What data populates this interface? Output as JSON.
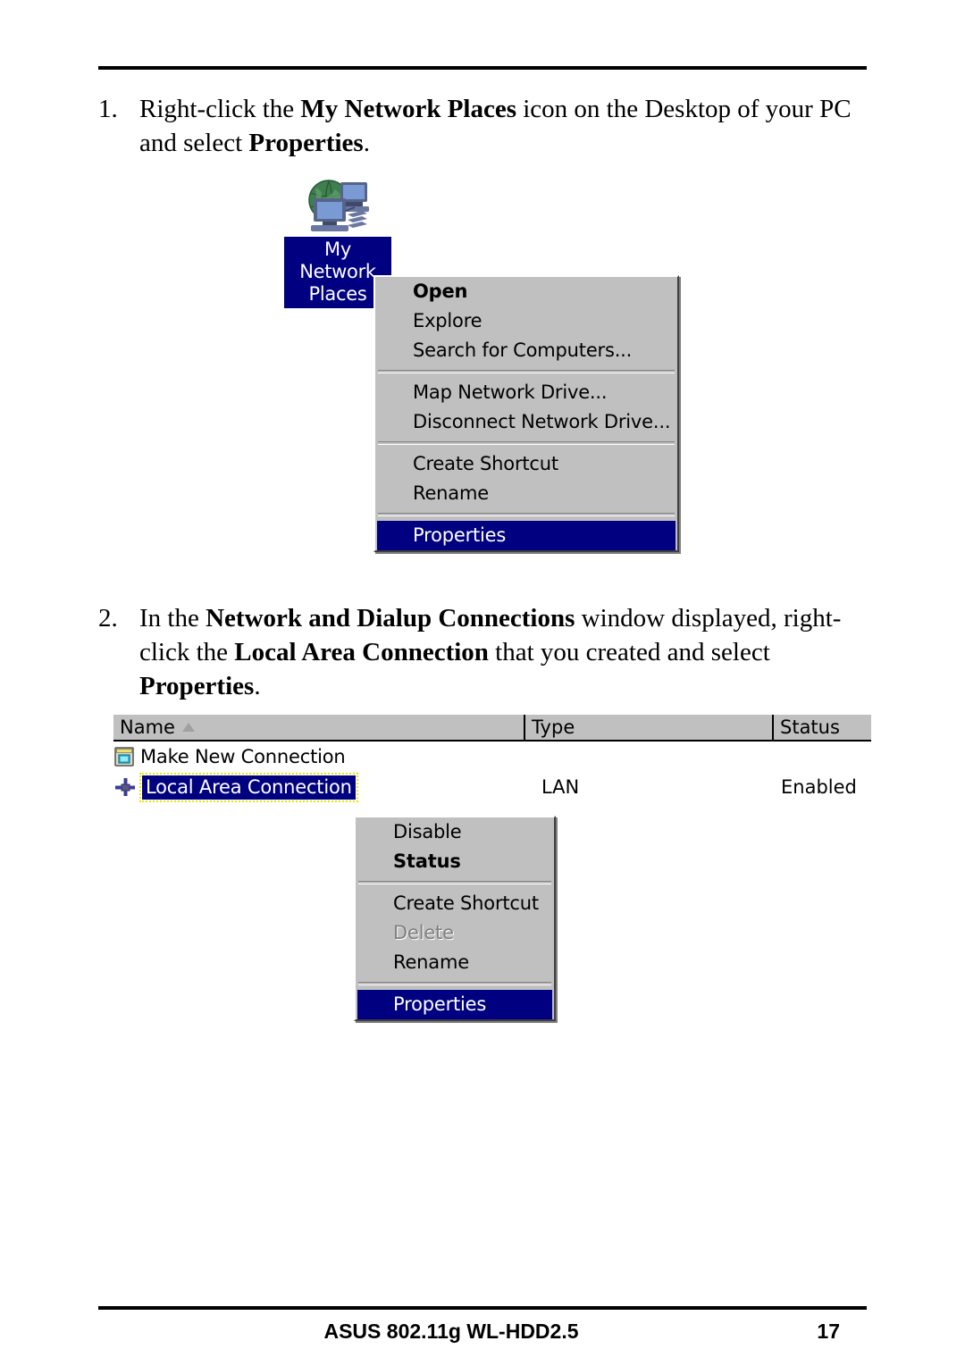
{
  "document": {
    "footer": {
      "center": "ASUS 802.11g WL-HDD2.5",
      "page_number": "17"
    }
  },
  "steps": [
    {
      "number": "1.",
      "parts": [
        {
          "text": "Right-click the ",
          "bold": false
        },
        {
          "text": "My Network Places",
          "bold": true
        },
        {
          "text": " icon on the Desktop of your PC and select ",
          "bold": false
        },
        {
          "text": "Properties",
          "bold": true
        },
        {
          "text": ".",
          "bold": false
        }
      ]
    },
    {
      "number": "2.",
      "parts": [
        {
          "text": "In the ",
          "bold": false
        },
        {
          "text": "Network and Dialup Connections",
          "bold": true
        },
        {
          "text": " window displayed, right-click the ",
          "bold": false
        },
        {
          "text": "Local Area Connection",
          "bold": true
        },
        {
          "text": " that you created and select ",
          "bold": false
        },
        {
          "text": "Properties",
          "bold": true
        },
        {
          "text": ".",
          "bold": false
        }
      ]
    }
  ],
  "figure1": {
    "desktop_icon": {
      "icon": "my-network-places-icon",
      "label": "My Network\nPlaces"
    },
    "context_menu": {
      "items": [
        {
          "label": "Open",
          "style": "bold"
        },
        {
          "label": "Explore",
          "style": "normal"
        },
        {
          "label": "Search for Computers...",
          "style": "normal"
        },
        {
          "label": "__separator__",
          "style": "separator"
        },
        {
          "label": "Map Network Drive...",
          "style": "normal"
        },
        {
          "label": "Disconnect Network Drive...",
          "style": "normal"
        },
        {
          "label": "__separator__",
          "style": "separator"
        },
        {
          "label": "Create Shortcut",
          "style": "normal"
        },
        {
          "label": "Rename",
          "style": "normal"
        },
        {
          "label": "__separator__",
          "style": "separator"
        },
        {
          "label": "Properties",
          "style": "selected"
        }
      ]
    }
  },
  "figure2": {
    "list": {
      "columns": [
        {
          "label": "Name",
          "sort_indicator": "ascending"
        },
        {
          "label": "Type",
          "sort_indicator": "none"
        },
        {
          "label": "Status",
          "sort_indicator": "none"
        }
      ],
      "rows": [
        {
          "icon": "make-new-connection-icon",
          "name": "Make New Connection",
          "type": "",
          "status": "",
          "selected": false
        },
        {
          "icon": "lan-connection-icon",
          "name": "Local Area Connection",
          "type": "LAN",
          "status": "Enabled",
          "selected": true
        }
      ]
    },
    "context_menu": {
      "items": [
        {
          "label": "Disable",
          "style": "normal"
        },
        {
          "label": "Status",
          "style": "bold"
        },
        {
          "label": "__separator__",
          "style": "separator"
        },
        {
          "label": "Create Shortcut",
          "style": "normal"
        },
        {
          "label": "Delete",
          "style": "disabled"
        },
        {
          "label": "Rename",
          "style": "normal"
        },
        {
          "label": "__separator__",
          "style": "separator"
        },
        {
          "label": "Properties",
          "style": "selected"
        }
      ]
    }
  },
  "colors": {
    "menu_face": "#c0c0c0",
    "selection": "#000080",
    "selection_text": "#ffffff",
    "disabled_text": "#808080",
    "focus_outline": "#e8e800"
  }
}
